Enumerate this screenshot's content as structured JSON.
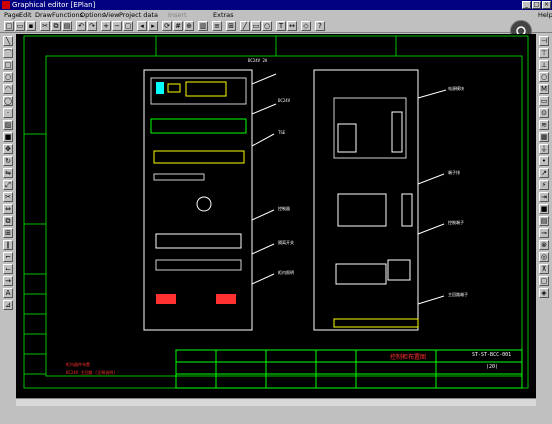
{
  "window": {
    "title": "Graphical editor [EPlan]"
  },
  "menu": [
    "Page",
    "Edit",
    "Draw",
    "Functions",
    "Options",
    "View",
    "Project data",
    "Insert",
    "Extras",
    "Help"
  ],
  "panel_labels": [
    "DC24V 2A",
    "DC24V",
    "TSE",
    "控制器",
    "隔离开关",
    "柜内照明",
    "电源模块",
    "端子排",
    "控制端子",
    "主回路端子"
  ],
  "title_block": {
    "drawing_name": "控制柜布置图",
    "drawing_number": "ST-ST-BCC-001",
    "sheet": "(20)"
  },
  "note_text": [
    "柜内器件布置",
    "DC24V 主回路 (注释说明)"
  ],
  "colors": {
    "canvas": "#000000",
    "border": "#00ff00",
    "frame": "#ffffff",
    "accent": "#ff3030",
    "hilite": "#ffff00"
  }
}
